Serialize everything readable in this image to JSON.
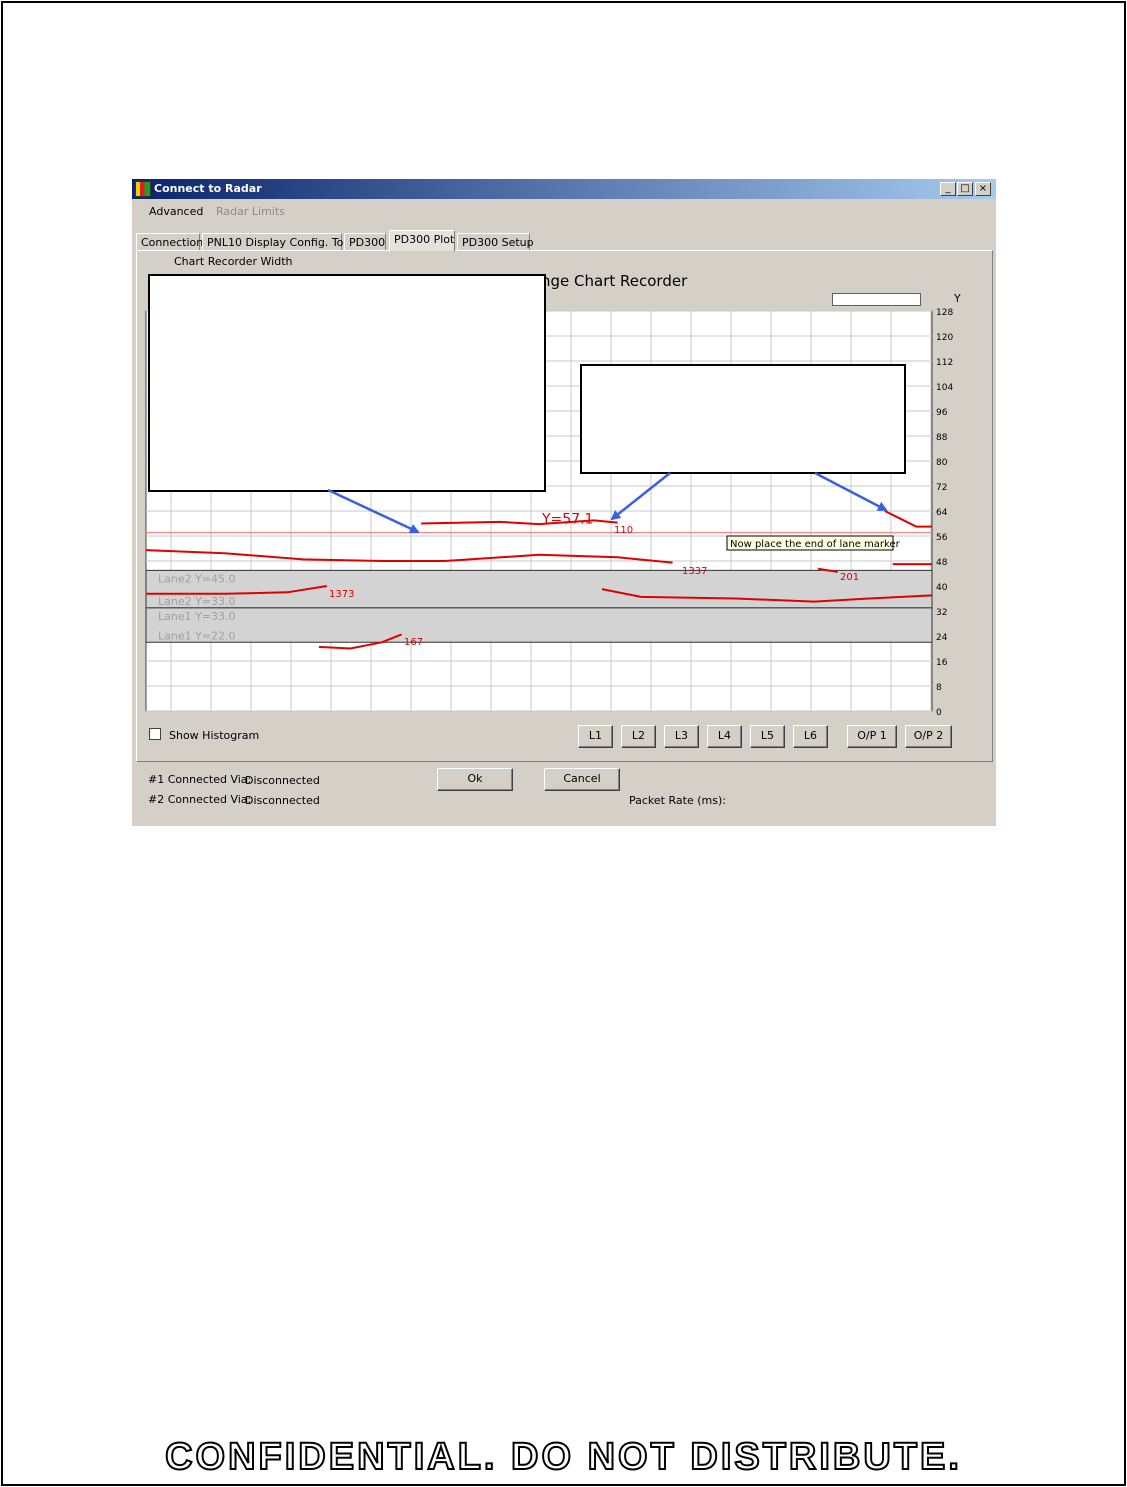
{
  "window": {
    "title": "Connect to Radar",
    "controls": {
      "minimize": "_",
      "maximize": "□",
      "close": "×"
    }
  },
  "menu": {
    "items": [
      {
        "label": "Advanced"
      },
      {
        "label": "Radar Limits"
      }
    ]
  },
  "tabs": [
    {
      "label": "Connection"
    },
    {
      "label": "PNL10 Display Config. Tool"
    },
    {
      "label": "PD300"
    },
    {
      "label": "PD300 Plot"
    },
    {
      "label": "PD300 Setup"
    }
  ],
  "active_tab": "PD300 Plot",
  "chart_panel": {
    "width_label": "Chart Recorder Width",
    "title_fragment": "nge Chart Recorder",
    "y_axis_label": "Y",
    "y_ticks": [
      "128",
      "120",
      "112",
      "104",
      "96",
      "88",
      "80",
      "72",
      "64",
      "56",
      "48",
      "40",
      "32",
      "24",
      "16",
      "8",
      "0"
    ],
    "marker_label": "Y=57.1",
    "tooltip": "Now place the end of lane marker",
    "lane_labels": [
      "Lane2 Y=45.0",
      "Lane2 Y=33.0",
      "Lane1 Y=33.0",
      "Lane1 Y=22.0"
    ],
    "track_ids": [
      "110",
      "1337",
      "201",
      "1373",
      "167"
    ]
  },
  "chart_data": {
    "type": "line",
    "ylim": [
      0,
      128
    ],
    "y_ticks": [
      128,
      120,
      112,
      104,
      96,
      88,
      80,
      72,
      64,
      56,
      48,
      40,
      32,
      24,
      16,
      8,
      0
    ],
    "reference_line": {
      "label": "Y=57.1",
      "y": 57.1
    },
    "lane_bands": [
      {
        "name": "Lane2",
        "y_top": 45.0,
        "y_bottom": 33.0
      },
      {
        "name": "Lane1",
        "y_top": 33.0,
        "y_bottom": 22.0
      }
    ],
    "tracks": [
      {
        "id": "110",
        "points": [
          [
            0.35,
            60.0
          ],
          [
            0.45,
            60.5
          ],
          [
            0.5,
            59.8
          ],
          [
            0.57,
            61.0
          ],
          [
            0.6,
            60.3
          ]
        ]
      },
      {
        "id": "1337",
        "points": [
          [
            0.0,
            51.5
          ],
          [
            0.1,
            50.5
          ],
          [
            0.2,
            48.5
          ],
          [
            0.3,
            48.0
          ],
          [
            0.38,
            48.0
          ],
          [
            0.5,
            50.0
          ],
          [
            0.6,
            49.2
          ],
          [
            0.67,
            47.5
          ]
        ]
      },
      {
        "id": "201",
        "points": [
          [
            0.855,
            45.5
          ],
          [
            0.88,
            44.5
          ]
        ]
      },
      {
        "id": "1373",
        "points": [
          [
            0.0,
            37.5
          ],
          [
            0.1,
            37.5
          ],
          [
            0.18,
            38.0
          ],
          [
            0.23,
            40.0
          ]
        ]
      },
      {
        "id": "1337b",
        "points": [
          [
            0.58,
            39.0
          ],
          [
            0.63,
            36.5
          ],
          [
            0.75,
            36.0
          ],
          [
            0.85,
            35.0
          ],
          [
            0.92,
            36.0
          ],
          [
            1.0,
            37.0
          ]
        ]
      },
      {
        "id": "167",
        "points": [
          [
            0.22,
            20.5
          ],
          [
            0.26,
            20.0
          ],
          [
            0.3,
            22.0
          ],
          [
            0.325,
            24.5
          ]
        ]
      },
      {
        "id": "tail",
        "points": [
          [
            0.94,
            64.0
          ],
          [
            0.96,
            61.5
          ],
          [
            0.98,
            59.0
          ],
          [
            1.0,
            59.0
          ]
        ]
      },
      {
        "id": "tail2",
        "points": [
          [
            0.95,
            47.0
          ],
          [
            1.0,
            47.0
          ]
        ]
      }
    ]
  },
  "show_histogram_label": "Show Histogram",
  "lane_buttons": [
    "L1",
    "L2",
    "L3",
    "L4",
    "L5",
    "L6",
    "O/P 1",
    "O/P 2"
  ],
  "status": {
    "conn1_label": "#1 Connected Via:",
    "conn1_value": "Disconnected",
    "conn2_label": "#2 Connected Via:",
    "conn2_value": "Disconnected",
    "packet_rate_label": "Packet Rate (ms):"
  },
  "dialog_buttons": {
    "ok": "Ok",
    "cancel": "Cancel"
  },
  "footer": "CONFIDENTIAL. DO NOT DISTRIBUTE.",
  "colors": {
    "title_start": "#0a246a",
    "title_end": "#a6caf0",
    "track": "#e00000",
    "arrow": "#3b5fe0",
    "lane_band": "#d3d3d3"
  }
}
